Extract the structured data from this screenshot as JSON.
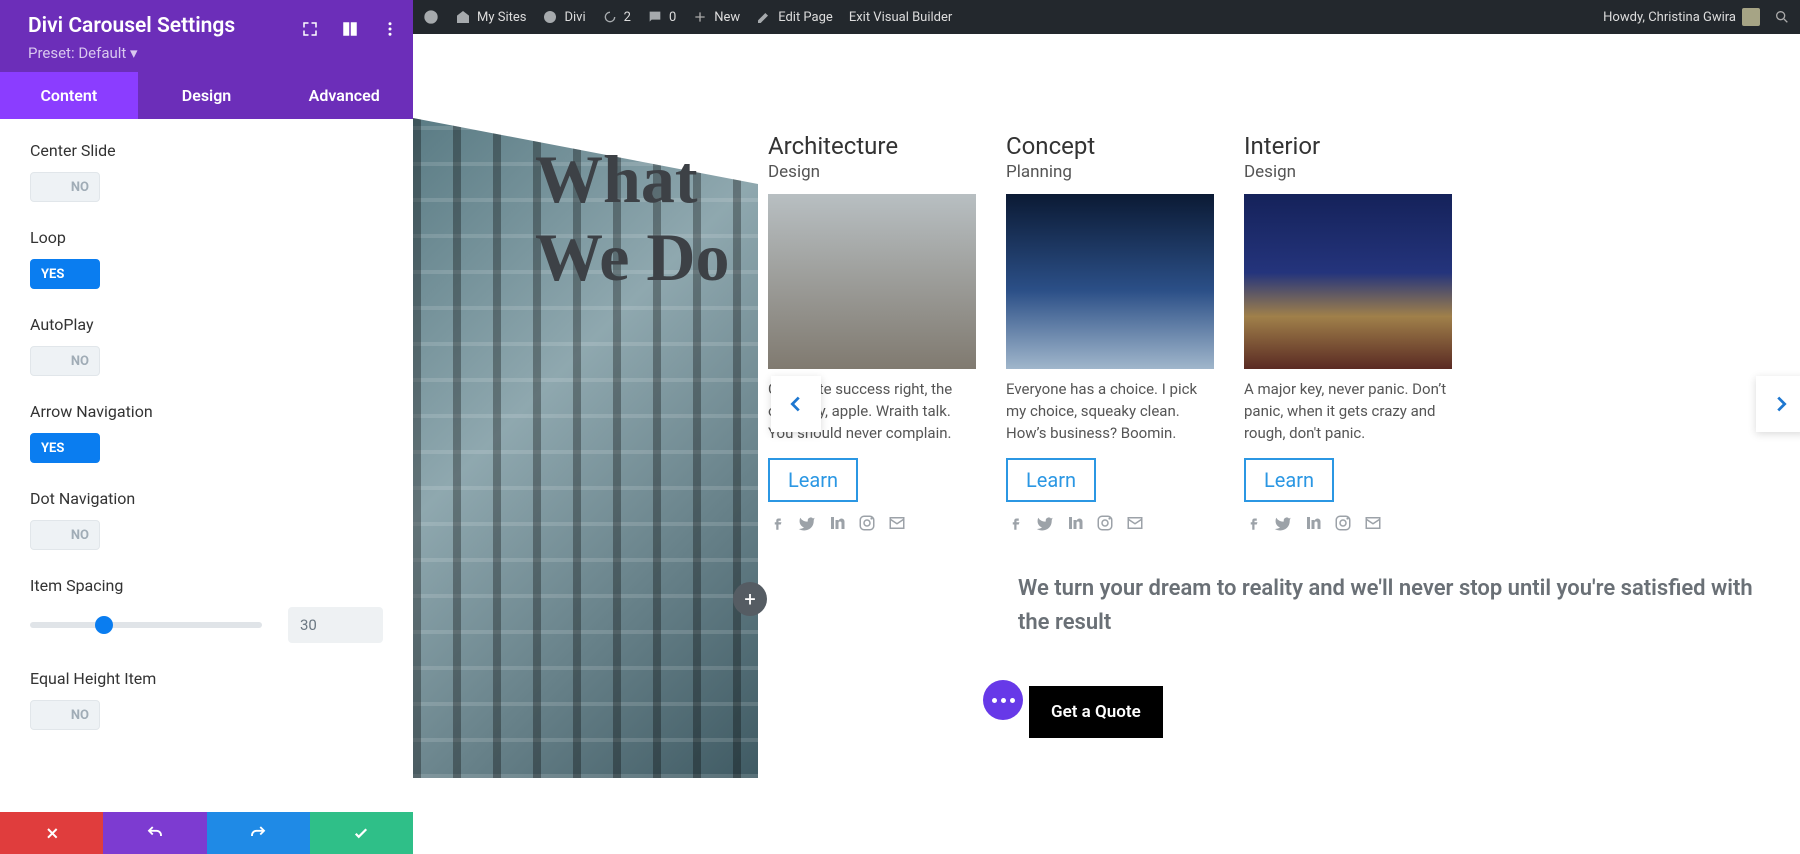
{
  "panel": {
    "title": "Divi Carousel Settings",
    "preset": "Preset: Default ▾",
    "tabs": {
      "content": "Content",
      "design": "Design",
      "advanced": "Advanced"
    },
    "settings": {
      "center_slide": {
        "label": "Center Slide",
        "value": "NO"
      },
      "loop": {
        "label": "Loop",
        "value": "YES"
      },
      "autoplay": {
        "label": "AutoPlay",
        "value": "NO"
      },
      "arrow_nav": {
        "label": "Arrow Navigation",
        "value": "YES"
      },
      "dot_nav": {
        "label": "Dot Navigation",
        "value": "NO"
      },
      "item_spacing": {
        "label": "Item Spacing",
        "value": "30"
      },
      "equal_height": {
        "label": "Equal Height Item",
        "value": "NO"
      }
    }
  },
  "adminbar": {
    "my_sites": "My Sites",
    "site_name": "Divi",
    "updates": "2",
    "comments": "0",
    "new": "New",
    "edit": "Edit Page",
    "exit": "Exit Visual Builder",
    "howdy": "Howdy, Christina Gwira"
  },
  "page": {
    "hero_title_1": "What",
    "hero_title_2": "We Do",
    "cards": [
      {
        "title": "Architecture",
        "sub": "Design",
        "desc": " Celebrate success right, the only way, apple. Wraith talk. You should never complain.",
        "cta": "Learn"
      },
      {
        "title": "Concept",
        "sub": "Planning",
        "desc": "Everyone has a choice. I pick my choice, squeaky clean. How’s business? Boomin.",
        "cta": "Learn"
      },
      {
        "title": "Interior",
        "sub": "Design",
        "desc": "A major key, never panic. Don’t panic, when it gets crazy and rough, don't panic.",
        "cta": "Learn"
      }
    ],
    "tagline": "We turn your dream to reality and we'll never stop until you're satisfied with the result",
    "quote": "Get a Quote"
  }
}
